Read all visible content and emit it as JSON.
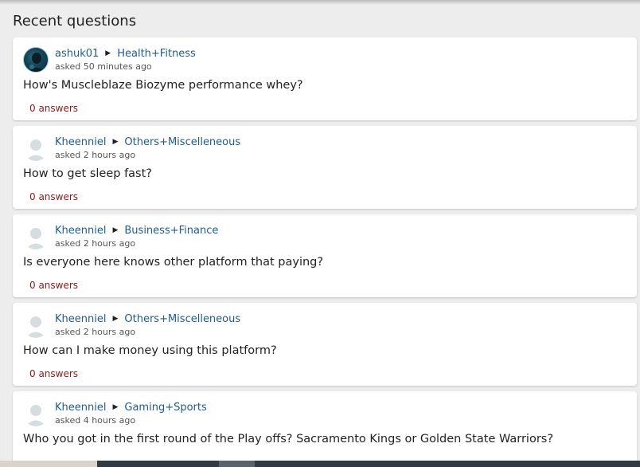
{
  "page": {
    "title": "Recent questions"
  },
  "questions": [
    {
      "user": "ashuk01",
      "avatar": "user-photo",
      "category": "Health+Fitness",
      "asked": "asked 50 minutes ago",
      "title": "How's Muscleblaze Biozyme performance whey?",
      "answers": "0 answers"
    },
    {
      "user": "Kheenniel",
      "avatar": "default-avatar",
      "category": "Others+Miscelleneous",
      "asked": "asked 2 hours ago",
      "title": "How to get sleep fast?",
      "answers": "0 answers"
    },
    {
      "user": "Kheenniel",
      "avatar": "default-avatar",
      "category": "Business+Finance",
      "asked": "asked 2 hours ago",
      "title": "Is everyone here knows other platform that paying?",
      "answers": "0 answers"
    },
    {
      "user": "Kheenniel",
      "avatar": "default-avatar",
      "category": "Others+Miscelleneous",
      "asked": "asked 2 hours ago",
      "title": "How can I make money using this platform?",
      "answers": "0 answers"
    },
    {
      "user": "Kheenniel",
      "avatar": "default-avatar",
      "category": "Gaming+Sports",
      "asked": "asked 4 hours ago",
      "title": "Who you got in the first round of the Play offs? Sacramento Kings or Golden State Warriors?",
      "answers": ""
    }
  ],
  "colors": {
    "background": "#ededed",
    "link": "#1f5c8a",
    "answers": "#8b1a1a"
  }
}
